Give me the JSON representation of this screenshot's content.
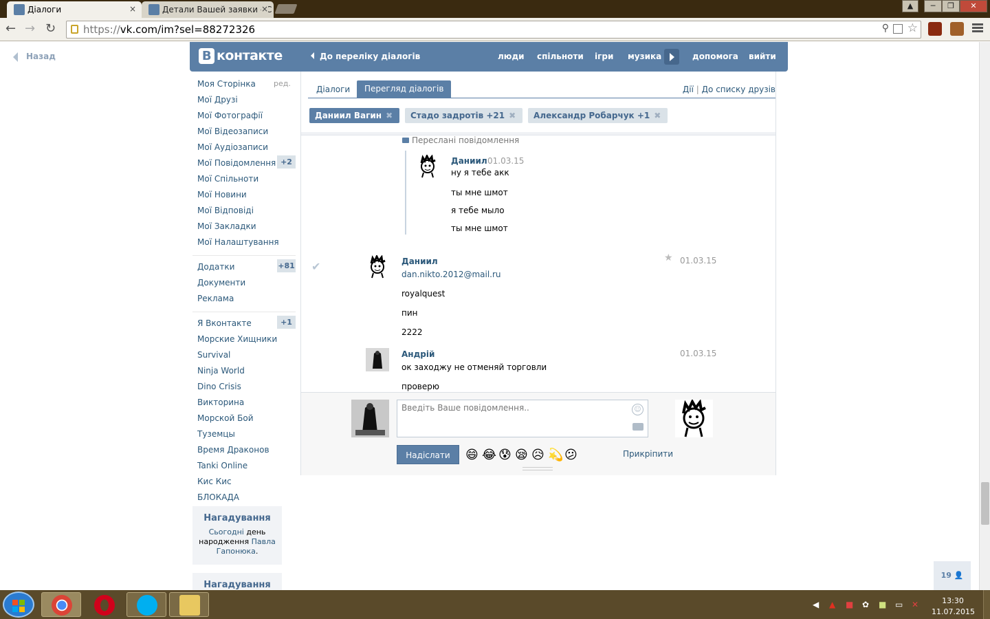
{
  "browser": {
    "tabs": [
      {
        "title": "Діалоги",
        "close": "×"
      },
      {
        "title": "Детали Вашей заявки - С",
        "close": "×"
      }
    ],
    "window_controls": [
      "─",
      "❐",
      "✕"
    ],
    "url_scheme": "https://",
    "url_rest": "vk.com/im?sel=88272326"
  },
  "page": {
    "back_label": "Назад",
    "header": {
      "logo_letter": "В",
      "logo_text": "контакте",
      "back_to_dialogs": "До переліку діалогів",
      "nav": [
        "люди",
        "спільноти",
        "ігри",
        "музика",
        "допомога",
        "вийти"
      ]
    },
    "sidebar": {
      "edit_label": "ред.",
      "main_items": [
        {
          "label": "Моя Сторінка",
          "count": ""
        },
        {
          "label": "Мої Друзі",
          "count": ""
        },
        {
          "label": "Мої Фотографії",
          "count": ""
        },
        {
          "label": "Мої Відеозаписи",
          "count": ""
        },
        {
          "label": "Мої Аудіозаписи",
          "count": ""
        },
        {
          "label": "Мої Повідомлення",
          "count": "+2"
        },
        {
          "label": "Мої Спільноти",
          "count": ""
        },
        {
          "label": "Мої Новини",
          "count": ""
        },
        {
          "label": "Мої Відповіді",
          "count": ""
        },
        {
          "label": "Мої Закладки",
          "count": ""
        },
        {
          "label": "Мої Налаштування",
          "count": ""
        }
      ],
      "apps_items": [
        {
          "label": "Додатки",
          "count": "+81"
        },
        {
          "label": "Документи",
          "count": ""
        },
        {
          "label": "Реклама",
          "count": ""
        }
      ],
      "game_items": [
        {
          "label": "Я Вконтакте",
          "count": "+1"
        },
        {
          "label": "Морские Хищники",
          "count": ""
        },
        {
          "label": "Survival",
          "count": ""
        },
        {
          "label": "Ninja World",
          "count": ""
        },
        {
          "label": "Dino Crisis",
          "count": ""
        },
        {
          "label": "Викторина",
          "count": ""
        },
        {
          "label": "Морской Бой",
          "count": ""
        },
        {
          "label": "Туземцы",
          "count": ""
        },
        {
          "label": "Время Драконов",
          "count": ""
        },
        {
          "label": "Tanki Online",
          "count": ""
        },
        {
          "label": "Кис Кис",
          "count": ""
        },
        {
          "label": "БЛОКАДА",
          "count": ""
        }
      ],
      "reminder1": {
        "title": "Нагадування",
        "today": "Сьогодні",
        "text1": " день народження ",
        "person": "Павла Гапонюка",
        "dot": "."
      },
      "reminder2": {
        "title": "Нагадування"
      }
    },
    "dialog": {
      "tab_dialogs": "Діалоги",
      "tab_view": "Перегляд діалогів",
      "actions": "Дії",
      "divider": "|",
      "to_friends": "До списку друзів",
      "chips": [
        {
          "label": "Даниил Вагин",
          "x": "✖"
        },
        {
          "label": "Стадо задротів +21",
          "x": "✖"
        },
        {
          "label": "Александр Робарчук +1",
          "x": "✖"
        }
      ],
      "forwarded_label": "Переслані повідомлення",
      "forwarded": {
        "name": "Даниил",
        "date": "01.03.15",
        "lines": [
          "ну я тебе акк",
          "ты мне шмот",
          "я тебе мыло",
          "ты мне шмот"
        ]
      },
      "msg1": {
        "name": "Даниил",
        "date": "01.03.15",
        "link": "dan.nikto.2012@mail.ru",
        "lines": [
          "royalquest",
          "пин",
          "2222"
        ]
      },
      "msg2": {
        "name": "Андрій",
        "date": "01.03.15",
        "lines": [
          "ок заходжу не отменяй торговли",
          "проверю"
        ]
      },
      "compose": {
        "placeholder": "Введіть Ваше повідомлення..",
        "send": "Надіслати",
        "attach": "Прикріпити",
        "emojis": [
          "😄",
          "😂",
          "😰",
          "😪",
          "😥",
          "💫",
          "😕"
        ]
      }
    },
    "online_count": "19"
  },
  "taskbar": {
    "time": "13:30",
    "date": "11.07.2015"
  },
  "icons": [
    "back-arrow-icon",
    "forward-arrow-icon",
    "reload-icon",
    "lock-icon",
    "zoom-icon",
    "translate-icon",
    "bookmark-star-icon",
    "menu-icon",
    "vk-logo",
    "play-icon",
    "check-icon",
    "star-icon",
    "smiley-icon",
    "camera-icon",
    "user-icon",
    "windows-start-icon",
    "chrome-icon",
    "opera-icon",
    "skype-icon",
    "explorer-icon"
  ]
}
